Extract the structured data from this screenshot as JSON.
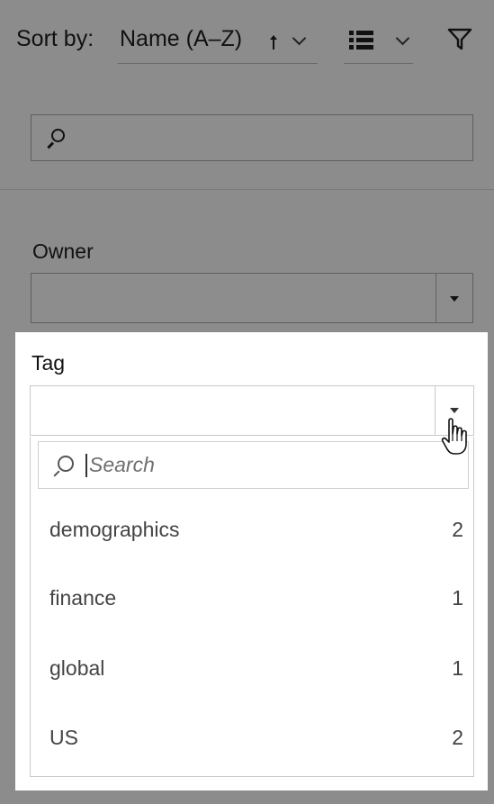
{
  "toolbar": {
    "sort_label": "Sort by:",
    "sort_value": "Name (A–Z)",
    "sort_direction_icon": "arrow-up-icon",
    "view_icon": "list-view-icon",
    "filter_icon": "filter-funnel-icon"
  },
  "search": {
    "icon": "search-icon",
    "value": ""
  },
  "owner": {
    "label": "Owner",
    "selected": ""
  },
  "tag": {
    "label": "Tag",
    "selected": "",
    "dropdown": {
      "search_placeholder": "Search",
      "options": [
        {
          "name": "demographics",
          "count": "2"
        },
        {
          "name": "finance",
          "count": "1"
        },
        {
          "name": "global",
          "count": "1"
        },
        {
          "name": "US",
          "count": "2"
        }
      ]
    }
  },
  "colors": {
    "overlay": "#8c8c8c",
    "panel": "#ffffff",
    "text_dark": "#111111",
    "text_option": "#444444"
  }
}
